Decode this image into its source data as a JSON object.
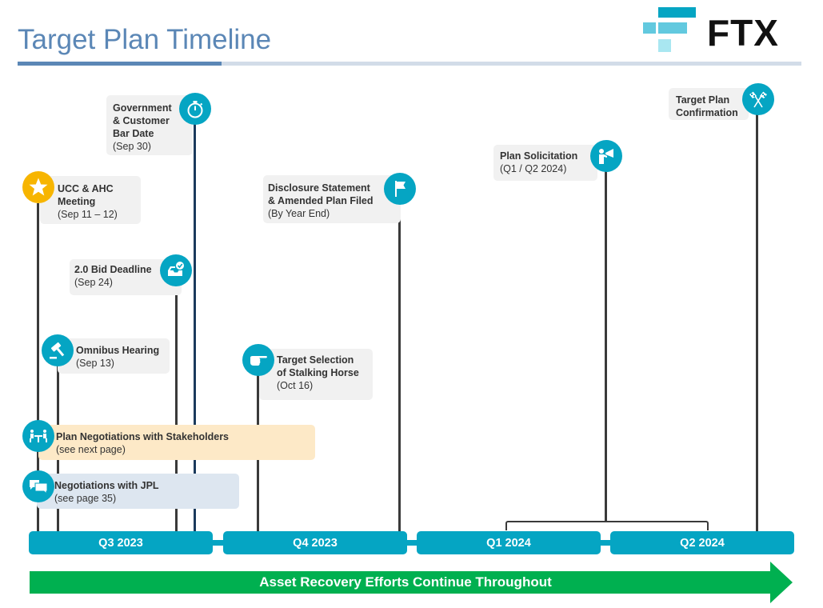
{
  "header": {
    "title": "Target Plan Timeline",
    "logo_text": "FTX"
  },
  "colors": {
    "accent_teal": "#05a5c3",
    "star_yellow": "#f7b500",
    "title_blue": "#5b87b6",
    "arrow_green": "#00b050",
    "card_gray": "#f1f1f1",
    "card_peach": "#fde9c7",
    "card_blue": "#dde6f0"
  },
  "milestones": [
    {
      "id": "bar-date",
      "title": "Government & Customer Bar Date",
      "title_lines": [
        "Government",
        "& Customer",
        "Bar Date"
      ],
      "date": "(Sep 30)",
      "icon": "stopwatch-icon",
      "quarter": "Q3 2023"
    },
    {
      "id": "ucc-ahc",
      "title": "UCC & AHC Meeting",
      "title_lines": [
        "UCC & AHC",
        "Meeting"
      ],
      "date": "(Sep 11 – 12)",
      "icon": "star-icon",
      "quarter": "Q3 2023"
    },
    {
      "id": "bid-deadline",
      "title": "2.0 Bid Deadline",
      "title_lines": [
        "2.0 Bid Deadline"
      ],
      "date": "(Sep 24)",
      "icon": "inbox-check-icon",
      "quarter": "Q3 2023"
    },
    {
      "id": "omnibus",
      "title": "Omnibus Hearing",
      "title_lines": [
        "Omnibus Hearing"
      ],
      "date": "(Sep 13)",
      "icon": "gavel-icon",
      "quarter": "Q3 2023"
    },
    {
      "id": "disclosure",
      "title": "Disclosure Statement & Amended Plan Filed",
      "title_lines": [
        "Disclosure Statement",
        "& Amended Plan Filed"
      ],
      "date": "(By Year End)",
      "icon": "flag-icon",
      "quarter": "Q4 2023"
    },
    {
      "id": "stalking-horse",
      "title": "Target Selection of Stalking Horse",
      "title_lines": [
        "Target Selection",
        "of Stalking Horse"
      ],
      "date": "(Oct 16)",
      "icon": "pointing-hand-icon",
      "quarter": "Q4 2023"
    },
    {
      "id": "solicitation",
      "title": "Plan Solicitation",
      "title_lines": [
        "Plan Solicitation"
      ],
      "date": "(Q1 / Q2 2024)",
      "icon": "megaphone-person-icon",
      "quarter": "Q1 2024 – Q2 2024"
    },
    {
      "id": "confirmation",
      "title": "Target Plan Confirmation",
      "title_lines": [
        "Target Plan",
        "Confirmation"
      ],
      "date": "",
      "icon": "checkered-flags-icon",
      "quarter": "Q2 2024"
    }
  ],
  "workstreams": [
    {
      "id": "plan-negotiations",
      "title": "Plan Negotiations with Stakeholders",
      "note": "(see next page)",
      "icon": "meeting-table-icon"
    },
    {
      "id": "jpl-negotiations",
      "title": "Negotiations with JPL",
      "note": "(see page 35)",
      "icon": "chat-bubbles-icon"
    }
  ],
  "quarters": [
    "Q3 2023",
    "Q4 2023",
    "Q1 2024",
    "Q2 2024"
  ],
  "banner": {
    "label": "Asset Recovery Efforts Continue Throughout"
  }
}
